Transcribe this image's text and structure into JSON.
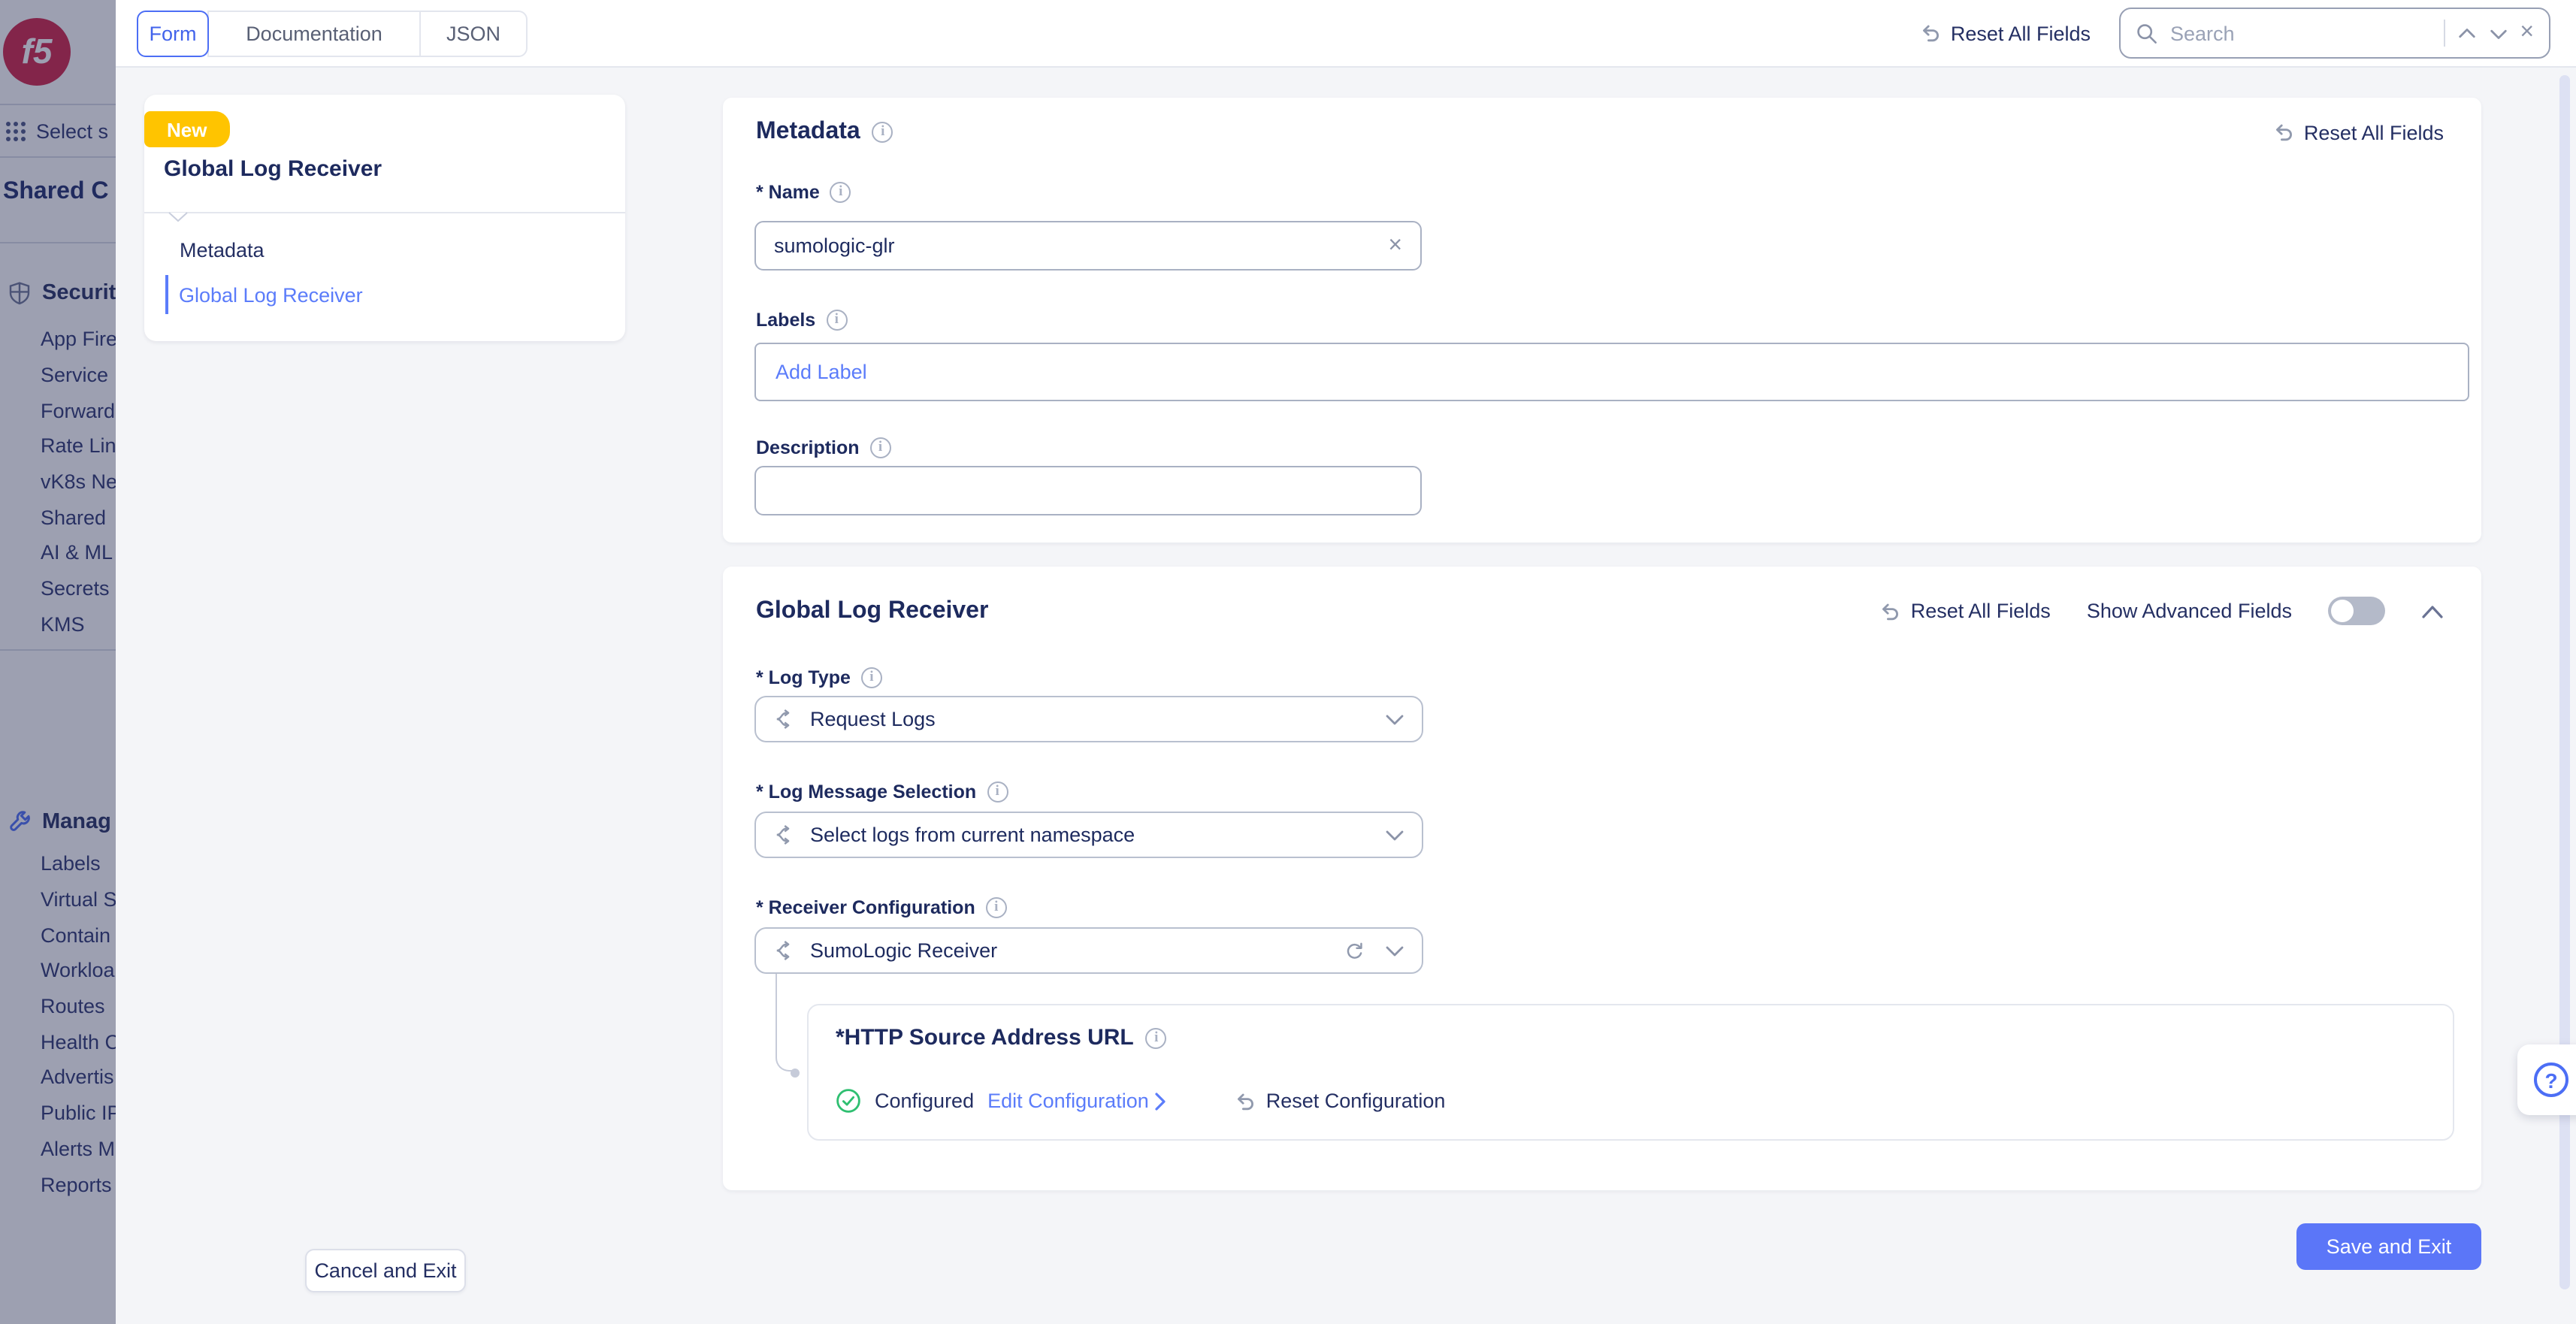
{
  "topbar": {
    "tabs": [
      {
        "label": "Form"
      },
      {
        "label": "Documentation"
      },
      {
        "label": "JSON"
      }
    ],
    "active_tab": "Form",
    "reset_all_label": "Reset All Fields",
    "search": {
      "placeholder": "Search"
    }
  },
  "sidebar": {
    "logo_text": "f5",
    "select_service": "Select s",
    "workspace_title": "Shared C",
    "sections": [
      {
        "icon": "shield-icon",
        "label": "Securit",
        "items": [
          "App Fire",
          "Service",
          "Forward",
          "Rate Lin",
          "vK8s Ne",
          "Shared",
          "AI & ML",
          "Secrets",
          "KMS"
        ]
      },
      {
        "icon": "wrench-icon",
        "label": "Manag",
        "items": [
          "Labels",
          "Virtual S",
          "Contain",
          "Workloa",
          "Routes",
          "Health C",
          "Advertis",
          "Public IP",
          "Alerts M",
          "Reports"
        ]
      }
    ]
  },
  "form_nav": {
    "badge": "New",
    "title": "Global Log Receiver",
    "items": [
      {
        "label": "Metadata",
        "active": false
      },
      {
        "label": "Global Log Receiver",
        "active": true
      }
    ]
  },
  "metadata_section": {
    "title": "Metadata",
    "reset_label": "Reset All Fields",
    "name": {
      "label": "* Name",
      "value": "sumologic-glr"
    },
    "labels": {
      "label": "Labels",
      "add_label": "Add Label"
    },
    "description": {
      "label": "Description",
      "value": ""
    }
  },
  "receiver_section": {
    "title": "Global Log Receiver",
    "reset_label": "Reset All Fields",
    "advanced_label": "Show Advanced Fields",
    "advanced_on": false,
    "log_type": {
      "label": "* Log Type",
      "value": "Request Logs"
    },
    "log_message_selection": {
      "label": "* Log Message Selection",
      "value": "Select logs from current namespace"
    },
    "receiver_configuration": {
      "label": "* Receiver Configuration",
      "value": "SumoLogic Receiver"
    },
    "http_source": {
      "title": "*HTTP Source Address URL",
      "status": "Configured",
      "edit_label": "Edit Configuration",
      "reset_label": "Reset Configuration"
    }
  },
  "footer": {
    "cancel_label": "Cancel and Exit",
    "save_label": "Save and Exit"
  },
  "colors": {
    "accent_blue": "#4c6ef5",
    "link_blue": "#5b7cfa",
    "badge_yellow": "#ffc400",
    "success_green": "#2fbf71",
    "navy_text": "#1d2a5e",
    "brand_red": "#cf1f44"
  }
}
